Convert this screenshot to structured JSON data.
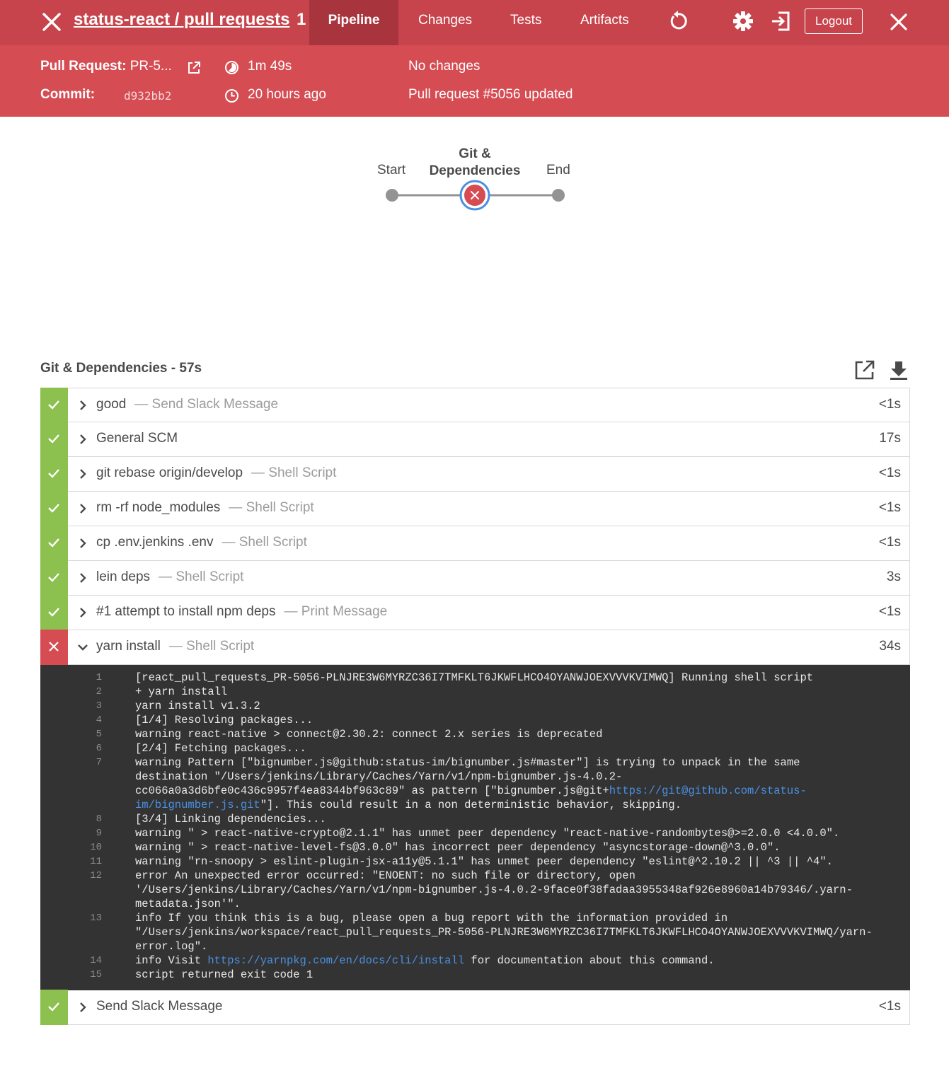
{
  "nav": {
    "title": "status-react / pull requests",
    "run_number": "1",
    "tabs": [
      "Pipeline",
      "Changes",
      "Tests",
      "Artifacts"
    ],
    "active_tab": "Pipeline",
    "logout_label": "Logout",
    "icons": [
      "close-icon",
      "replay-icon",
      "gear-icon",
      "exit-icon",
      "close-icon"
    ]
  },
  "info": {
    "pr_label": "Pull Request:",
    "pr_value": "PR-5...",
    "commit_label": "Commit:",
    "commit_value": "d932bb2",
    "duration": "1m 49s",
    "time_ago": "20 hours ago",
    "changes": "No changes",
    "cause": "Pull request #5056 updated"
  },
  "pipeline": {
    "start": "Start",
    "stage_line1": "Git &",
    "stage_line2": "Dependencies",
    "end": "End",
    "stage_status": "failed"
  },
  "stage": {
    "title": "Git & Dependencies - 57s",
    "steps": [
      {
        "name": "good",
        "desc": "— Send Slack Message",
        "duration": "<1s",
        "status": "success"
      },
      {
        "name": "General SCM",
        "desc": "",
        "duration": "17s",
        "status": "success"
      },
      {
        "name": "git rebase origin/develop",
        "desc": "— Shell Script",
        "duration": "<1s",
        "status": "success"
      },
      {
        "name": "rm -rf node_modules",
        "desc": "— Shell Script",
        "duration": "<1s",
        "status": "success"
      },
      {
        "name": "cp .env.jenkins .env",
        "desc": "— Shell Script",
        "duration": "<1s",
        "status": "success"
      },
      {
        "name": "lein deps",
        "desc": "— Shell Script",
        "duration": "3s",
        "status": "success"
      },
      {
        "name": "#1 attempt to install npm deps",
        "desc": "— Print Message",
        "duration": "<1s",
        "status": "success"
      },
      {
        "name": "yarn install",
        "desc": "— Shell Script",
        "duration": "34s",
        "status": "failed",
        "expanded": true
      }
    ],
    "last_step": {
      "name": "Send Slack Message",
      "desc": "",
      "duration": "<1s",
      "status": "success"
    }
  },
  "log": [
    {
      "n": "1",
      "t": "[react_pull_requests_PR-5056-PLNJRE3W6MYRZC36I7TMFKLT6JKWFLHCO4OYANWJOEXVVVKVIMWQ] Running shell script"
    },
    {
      "n": "2",
      "t": "+ yarn install"
    },
    {
      "n": "3",
      "t": "yarn install v1.3.2"
    },
    {
      "n": "4",
      "t": "[1/4] Resolving packages..."
    },
    {
      "n": "5",
      "t": "warning react-native > connect@2.30.2: connect 2.x series is deprecated"
    },
    {
      "n": "6",
      "t": "[2/4] Fetching packages..."
    },
    {
      "n": "7",
      "t": "warning Pattern [\"bignumber.js@github:status-im/bignumber.js#master\"] is trying to unpack in the same destination \"/Users/jenkins/Library/Caches/Yarn/v1/npm-bignumber.js-4.0.2-cc066a0a3d6bfe0c436c9957f4ea8344bf963c89\" as pattern [\"bignumber.js@git+",
      "link": "https://git@github.com/status-im/bignumber.js.git",
      "after": "\"]. This could result in a non deterministic behavior, skipping."
    },
    {
      "n": "8",
      "t": "[3/4] Linking dependencies..."
    },
    {
      "n": "9",
      "t": "warning \" > react-native-crypto@2.1.1\" has unmet peer dependency \"react-native-randombytes@>=2.0.0 <4.0.0\"."
    },
    {
      "n": "10",
      "t": "warning \" > react-native-level-fs@3.0.0\" has incorrect peer dependency \"asyncstorage-down@^3.0.0\"."
    },
    {
      "n": "11",
      "t": "warning \"rn-snoopy > eslint-plugin-jsx-a11y@5.1.1\" has unmet peer dependency \"eslint@^2.10.2 || ^3 || ^4\"."
    },
    {
      "n": "12",
      "t": "error An unexpected error occurred: \"ENOENT: no such file or directory, open '/Users/jenkins/Library/Caches/Yarn/v1/npm-bignumber.js-4.0.2-9face0f38fadaa3955348af926e8960a14b79346/.yarn-metadata.json'\"."
    },
    {
      "n": "13",
      "t": "info If you think this is a bug, please open a bug report with the information provided in \"/Users/jenkins/workspace/react_pull_requests_PR-5056-PLNJRE3W6MYRZC36I7TMFKLT6JKWFLHCO4OYANWJOEXVVVKVIMWQ/yarn-error.log\"."
    },
    {
      "n": "14",
      "t": "info Visit ",
      "link": "https://yarnpkg.com/en/docs/cli/install",
      "after": " for documentation about this command."
    },
    {
      "n": "15",
      "t": "script returned exit code 1"
    }
  ],
  "colors": {
    "nav_bg": "#c8444c",
    "header_bg": "#d54c53",
    "success": "#8cc04f",
    "failure": "#d54c53",
    "selected_ring": "#4a90e2",
    "log_bg": "#333333"
  }
}
